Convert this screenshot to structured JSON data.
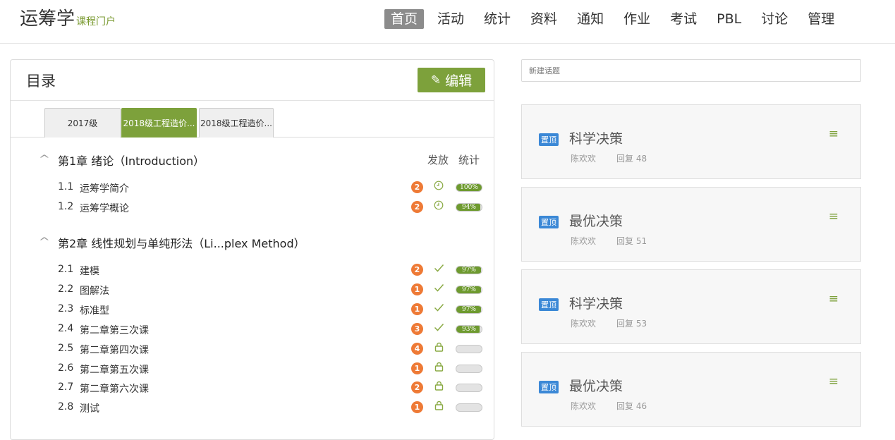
{
  "header": {
    "brand": "运筹学",
    "brand_sub": "课程门户",
    "nav": [
      "首页",
      "活动",
      "统计",
      "资料",
      "通知",
      "作业",
      "考试",
      "PBL",
      "讨论",
      "管理"
    ],
    "active_nav": "首页"
  },
  "toc": {
    "title": "目录",
    "edit_label": "编辑",
    "tabs": [
      "2017级",
      "2018级工程造价...",
      "2018级工程造价..."
    ],
    "col_release": "发放",
    "col_stats": "统计",
    "chapters": [
      {
        "title": "第1章  绪论（Introduction）",
        "lessons": [
          {
            "num": "1.1",
            "title": "运筹学简介",
            "count": "2",
            "status": "clock",
            "progress": 100,
            "progress_label": "100%"
          },
          {
            "num": "1.2",
            "title": "运筹学概论",
            "count": "2",
            "status": "clock",
            "progress": 94,
            "progress_label": "94%"
          }
        ]
      },
      {
        "title": "第2章  线性规划与单纯形法（Li...plex Method）",
        "lessons": [
          {
            "num": "2.1",
            "title": "建模",
            "count": "2",
            "status": "check",
            "progress": 97,
            "progress_label": "97%"
          },
          {
            "num": "2.2",
            "title": "图解法",
            "count": "1",
            "status": "check",
            "progress": 97,
            "progress_label": "97%"
          },
          {
            "num": "2.3",
            "title": "标准型",
            "count": "1",
            "status": "check",
            "progress": 97,
            "progress_label": "97%"
          },
          {
            "num": "2.4",
            "title": "第二章第三次课",
            "count": "3",
            "status": "check",
            "progress": 93,
            "progress_label": "93%"
          },
          {
            "num": "2.5",
            "title": "第二章第四次课",
            "count": "4",
            "status": "lock",
            "progress": 0,
            "progress_label": ""
          },
          {
            "num": "2.6",
            "title": "第二章第五次课",
            "count": "1",
            "status": "lock",
            "progress": 0,
            "progress_label": ""
          },
          {
            "num": "2.7",
            "title": "第二章第六次课",
            "count": "2",
            "status": "lock",
            "progress": 0,
            "progress_label": ""
          },
          {
            "num": "2.8",
            "title": "测试",
            "count": "1",
            "status": "lock",
            "progress": 0,
            "progress_label": ""
          }
        ]
      }
    ]
  },
  "forum": {
    "new_topic_placeholder": "新建话题",
    "pin_label": "置顶",
    "replies_prefix": "回复",
    "topics": [
      {
        "title": "科学决策",
        "author": "陈欢欢",
        "replies": "48"
      },
      {
        "title": "最优决策",
        "author": "陈欢欢",
        "replies": "51"
      },
      {
        "title": "科学决策",
        "author": "陈欢欢",
        "replies": "53"
      },
      {
        "title": "最优决策",
        "author": "陈欢欢",
        "replies": "46"
      }
    ]
  },
  "colors": {
    "accent": "#7da13b",
    "badge": "#ee7a36",
    "pin": "#3b88d6",
    "nav_active": "#8b8b8b"
  },
  "icons": {
    "edit": "pencil-icon",
    "chapter_toggle": "chevron-up-icon",
    "clock": "clock-icon",
    "check": "check-icon",
    "lock": "lock-icon",
    "topic_menu": "menu-icon"
  }
}
